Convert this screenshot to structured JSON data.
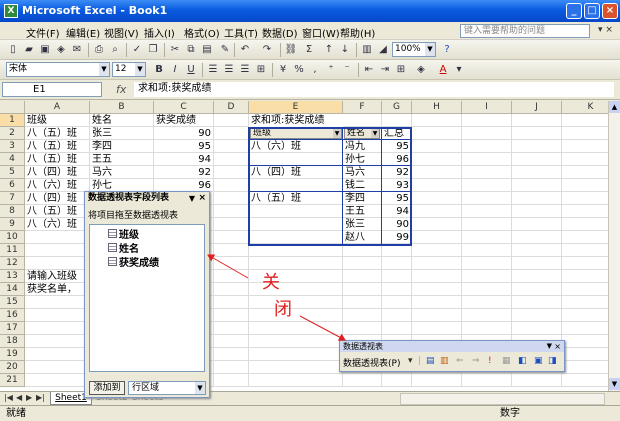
{
  "window": {
    "app_icon": "X",
    "title": "Microsoft Excel - Book1",
    "minimize": "_",
    "maximize": "□",
    "close": "×"
  },
  "menu": {
    "items": [
      "文件(F)",
      "编辑(E)",
      "视图(V)",
      "插入(I)",
      "格式(O)",
      "工具(T)",
      "数据(D)",
      "窗口(W)",
      "帮助(H)"
    ],
    "help_placeholder": "键入需要帮助的问题"
  },
  "toolbar": {
    "zoom": "100%"
  },
  "format_bar": {
    "font": "宋体",
    "size": "12",
    "bold": "B",
    "italic": "I",
    "underline": "U"
  },
  "formula_bar": {
    "name_box": "E1",
    "fx": "fx",
    "formula": "求和项:获奖成绩"
  },
  "columns": [
    "A",
    "B",
    "C",
    "D",
    "E",
    "F",
    "G",
    "H",
    "I",
    "J",
    "K"
  ],
  "rows": [
    "1",
    "2",
    "3",
    "4",
    "5",
    "6",
    "7",
    "8",
    "9",
    "10",
    "11",
    "12",
    "13",
    "14",
    "15",
    "16",
    "17",
    "18",
    "19",
    "20",
    "21"
  ],
  "data_table": {
    "headers": [
      "班级",
      "姓名",
      "获奖成绩"
    ],
    "rows": [
      [
        "八（五）班",
        "张三",
        "90"
      ],
      [
        "八（五）班",
        "李四",
        "95"
      ],
      [
        "八（五）班",
        "王五",
        "94"
      ],
      [
        "八（四）班",
        "马六",
        "92"
      ],
      [
        "八（六）班",
        "孙七",
        "96"
      ],
      [
        "八（四）班",
        "钱二",
        "93"
      ],
      [
        "八（五）班",
        "赵八",
        "99"
      ],
      [
        "八（六）班",
        "冯九",
        "95"
      ]
    ]
  },
  "notes": [
    "请输入班级",
    "获奖名单，"
  ],
  "pivot": {
    "title": "求和项:获奖成绩",
    "field_class": "班级",
    "field_name": "姓名",
    "total": "汇总",
    "groups": [
      {
        "class": "八（六）班",
        "rows": [
          [
            "冯九",
            "95"
          ],
          [
            "孙七",
            "96"
          ]
        ]
      },
      {
        "class": "八（四）班",
        "rows": [
          [
            "马六",
            "92"
          ],
          [
            "钱二",
            "93"
          ]
        ]
      },
      {
        "class": "八（五）班",
        "rows": [
          [
            "李四",
            "95"
          ],
          [
            "王五",
            "94"
          ],
          [
            "张三",
            "90"
          ],
          [
            "赵八",
            "99"
          ]
        ]
      }
    ]
  },
  "field_list": {
    "title": "数据透视表字段列表",
    "subtitle": "将项目拖至数据透视表",
    "items": [
      "班级",
      "姓名",
      "获奖成绩"
    ],
    "add_button": "添加到",
    "area": "行区域"
  },
  "pivot_toolbar": {
    "title": "数据透视表",
    "menu": "数据透视表(P)"
  },
  "annotation": {
    "char1": "关",
    "char2": "闭",
    "color": "#e02020"
  },
  "sheet_tabs": {
    "active": "Sheet1",
    "others": [
      "Sheet2",
      "Sheet3"
    ]
  },
  "status": {
    "left": "就绪",
    "right": "数字"
  }
}
